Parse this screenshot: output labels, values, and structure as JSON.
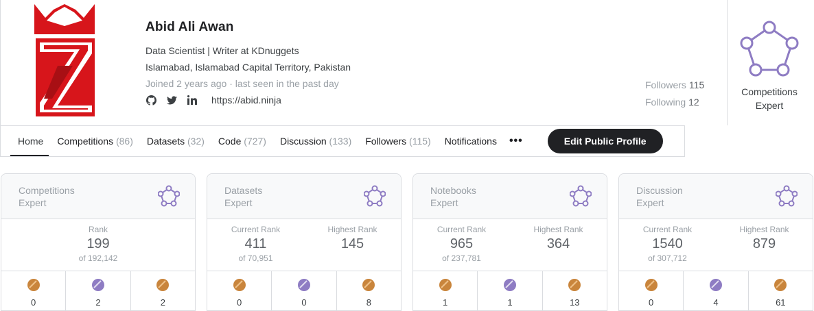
{
  "profile": {
    "name": "Abid Ali Awan",
    "headline": "Data Scientist | Writer at KDnuggets",
    "location": "Islamabad, Islamabad Capital Territory, Pakistan",
    "joined": "Joined 2 years ago · last seen in the past day",
    "website": "https://abid.ninja",
    "social_icons": [
      "github-icon",
      "twitter-icon",
      "linkedin-icon"
    ],
    "logo_color": "#d7151b"
  },
  "follow": {
    "followers_label": "Followers",
    "followers_count": "115",
    "following_label": "Following",
    "following_count": "12"
  },
  "tier": {
    "line1": "Competitions",
    "line2": "Expert",
    "icon": "expert-pentagon-icon",
    "color": "#8e7cc3"
  },
  "tabs": [
    {
      "label": "Home",
      "count": ""
    },
    {
      "label": "Competitions",
      "count": "(86)"
    },
    {
      "label": "Datasets",
      "count": "(32)"
    },
    {
      "label": "Code",
      "count": "(727)"
    },
    {
      "label": "Discussion",
      "count": "(133)"
    },
    {
      "label": "Followers",
      "count": "(115)"
    },
    {
      "label": "Notifications",
      "count": ""
    }
  ],
  "more_label": "•••",
  "edit_button": "Edit Public Profile",
  "cards": [
    {
      "tier1": "Competitions",
      "tier2": "Expert",
      "rank_label": "Rank",
      "rank": "199",
      "rank_of": "of 192,142",
      "highest_label": "",
      "highest": "",
      "medals": {
        "gold": "0",
        "silver": "2",
        "bronze": "2"
      }
    },
    {
      "tier1": "Datasets",
      "tier2": "Expert",
      "rank_label": "Current Rank",
      "rank": "411",
      "rank_of": "of 70,951",
      "highest_label": "Highest Rank",
      "highest": "145",
      "medals": {
        "gold": "0",
        "silver": "0",
        "bronze": "8"
      }
    },
    {
      "tier1": "Notebooks",
      "tier2": "Expert",
      "rank_label": "Current Rank",
      "rank": "965",
      "rank_of": "of 237,781",
      "highest_label": "Highest Rank",
      "highest": "364",
      "medals": {
        "gold": "1",
        "silver": "1",
        "bronze": "13"
      }
    },
    {
      "tier1": "Discussion",
      "tier2": "Expert",
      "rank_label": "Current Rank",
      "rank": "1540",
      "rank_of": "of 307,712",
      "highest_label": "Highest Rank",
      "highest": "879",
      "medals": {
        "gold": "0",
        "silver": "4",
        "bronze": "61"
      }
    }
  ],
  "colors": {
    "gold_medal": "#c9853c",
    "silver_medal": "#8e7cc3",
    "bronze_medal": "#c9853c",
    "tier_purple": "#8e7cc3"
  }
}
